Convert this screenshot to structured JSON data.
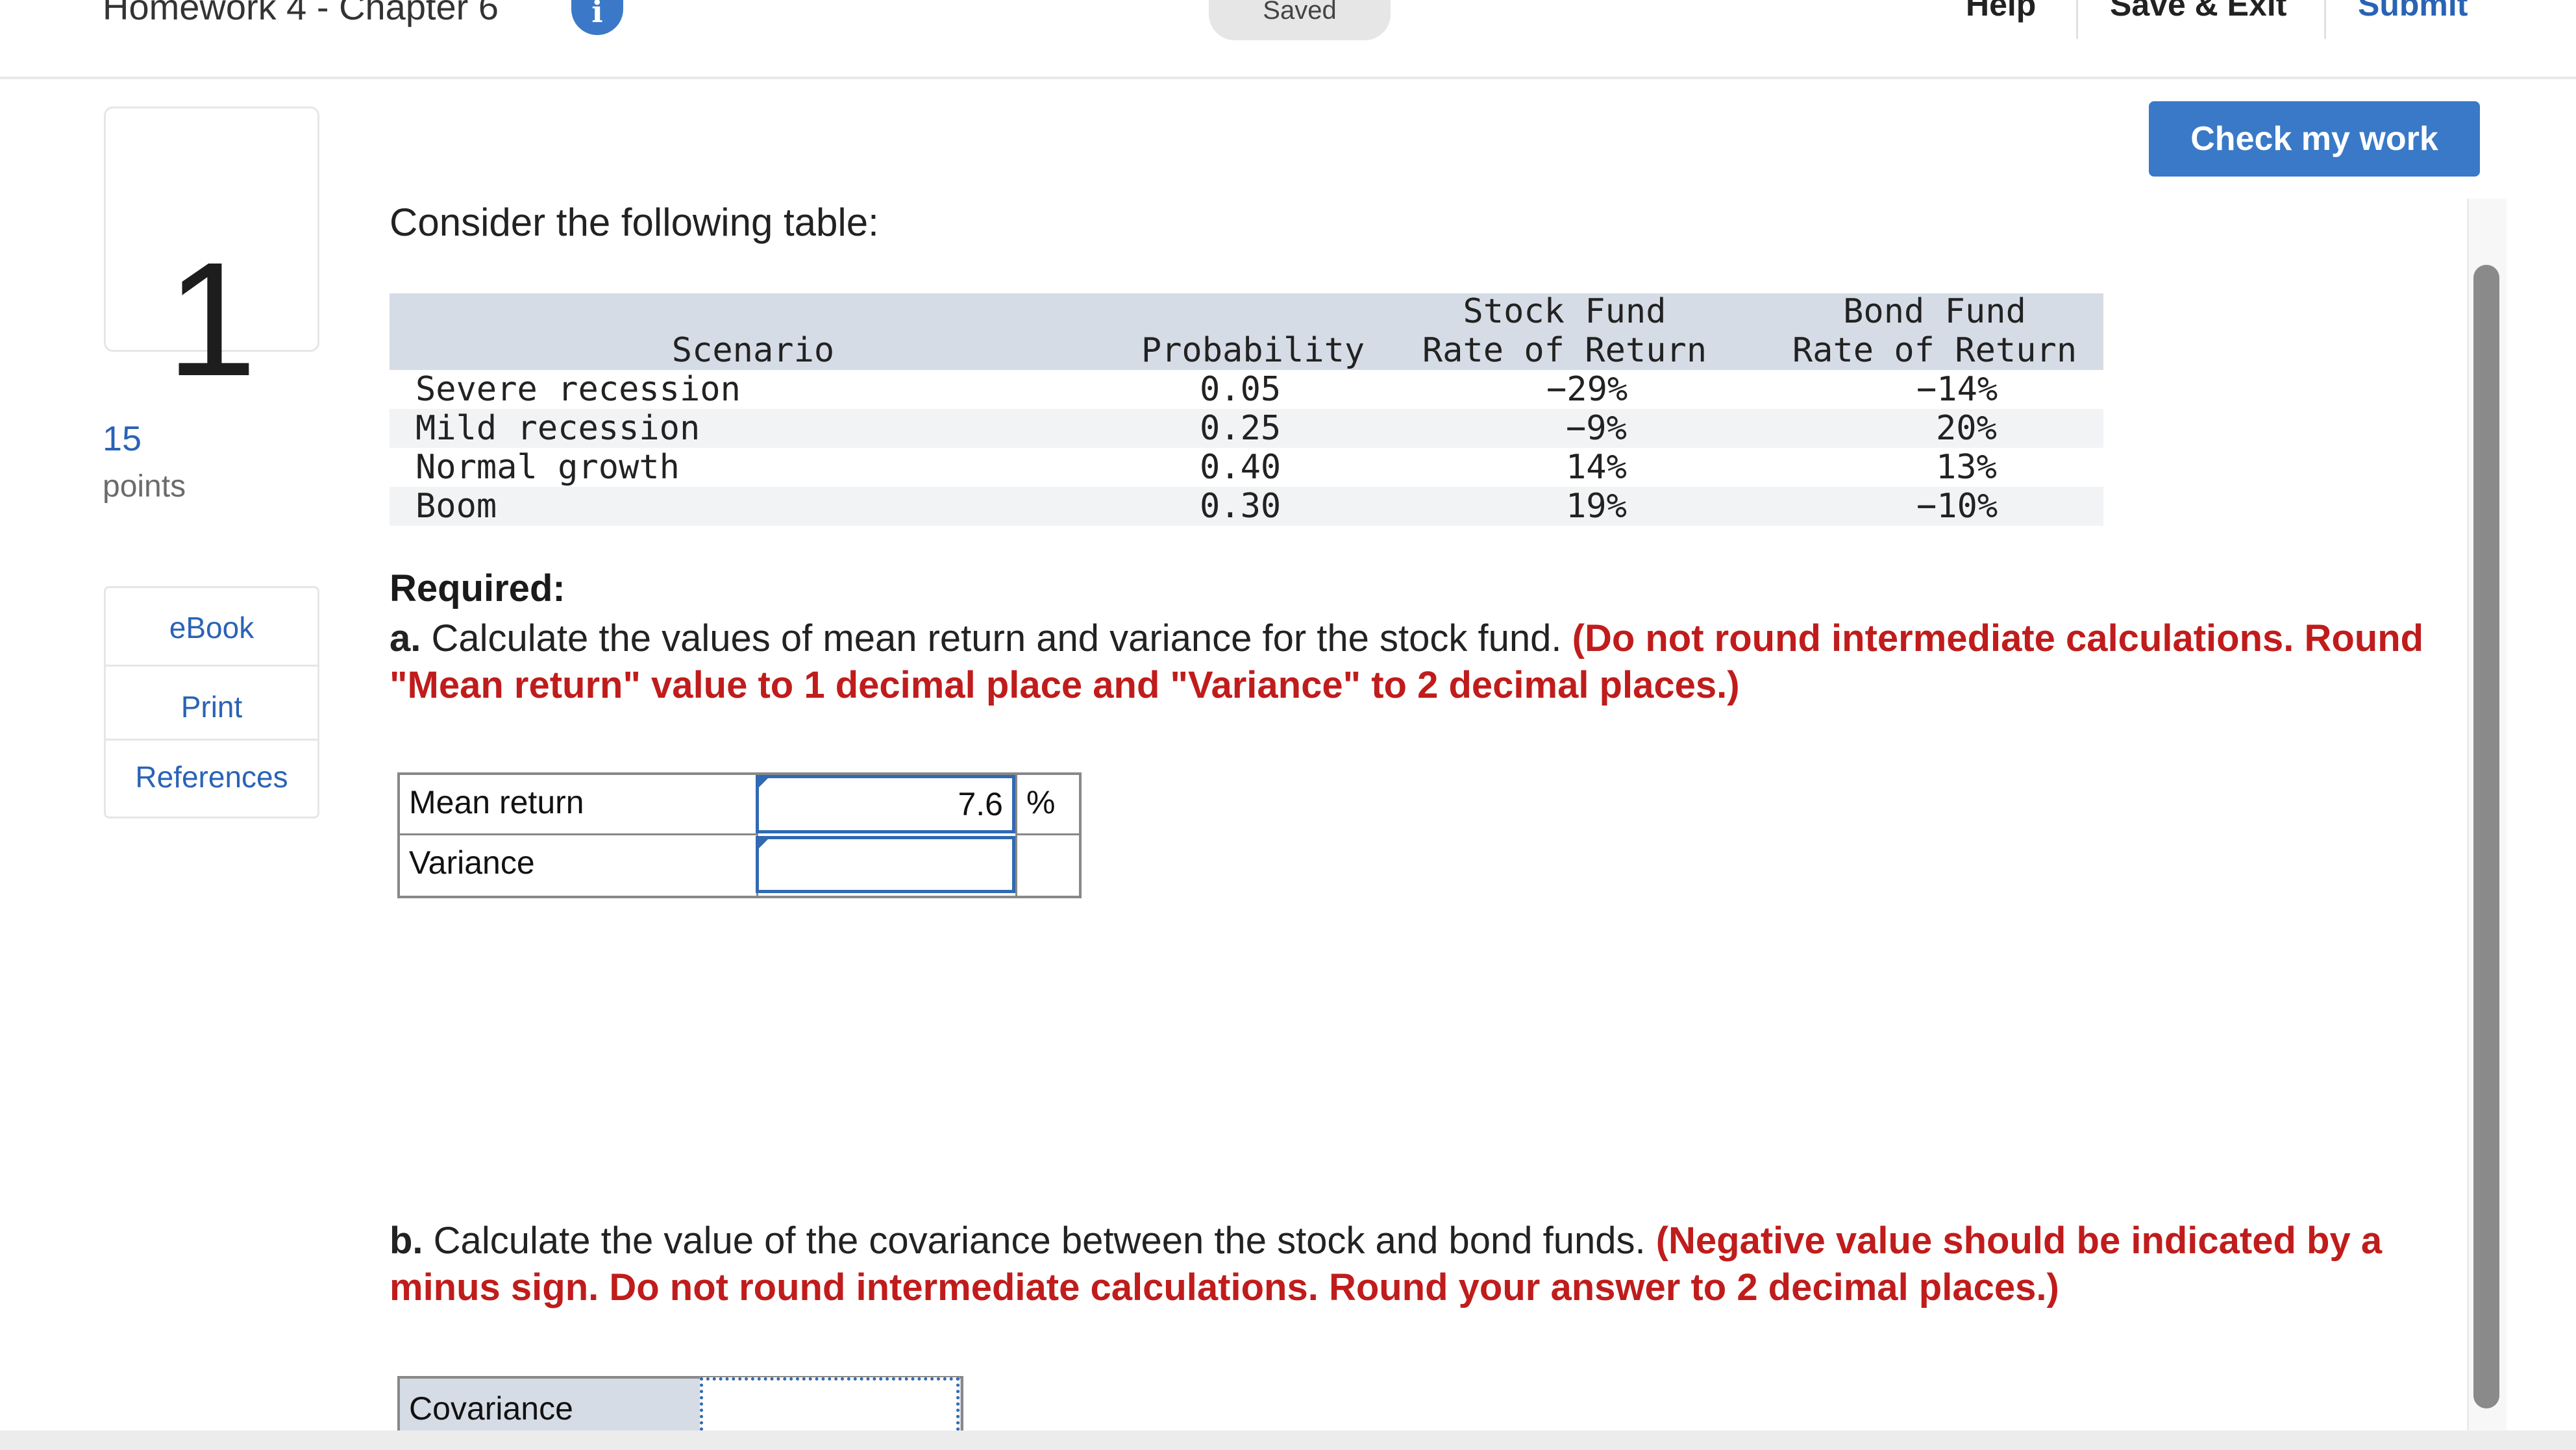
{
  "header": {
    "title": "Homework 4 - Chapter 6",
    "info_icon": "info-icon",
    "status": "Saved",
    "help": "Help",
    "save_exit": "Save & Exit",
    "submit": "Submit"
  },
  "question": {
    "number": "1",
    "points": "15",
    "points_label": "points"
  },
  "resources": [
    "eBook",
    "Print",
    "References"
  ],
  "check_button": "Check my work",
  "prompt": "Consider the following table:",
  "table": {
    "headers": {
      "scenario": "Scenario",
      "probability": "Probability",
      "stock_line1": "Stock Fund",
      "stock_line2": "Rate of Return",
      "bond_line1": "Bond Fund",
      "bond_line2": "Rate of Return"
    },
    "rows": [
      {
        "scenario": "Severe recession",
        "probability": "0.05",
        "stock": "−29%",
        "bond": "−14%"
      },
      {
        "scenario": "Mild recession",
        "probability": "0.25",
        "stock": "−9%",
        "bond": "20%"
      },
      {
        "scenario": "Normal growth",
        "probability": "0.40",
        "stock": "14%",
        "bond": "13%"
      },
      {
        "scenario": "Boom",
        "probability": "0.30",
        "stock": "19%",
        "bond": "−10%"
      }
    ]
  },
  "required": "Required:",
  "part_a": {
    "label": "a.",
    "text": "Calculate the values of mean return and variance for the stock fund.",
    "instruction": "(Do not round intermediate calculations. Round \"Mean return\" value to 1 decimal place and \"Variance\" to 2 decimal places.)",
    "rows": [
      {
        "label": "Mean return",
        "value": "7.6",
        "unit": "%"
      },
      {
        "label": "Variance",
        "value": "",
        "unit": ""
      }
    ]
  },
  "part_b": {
    "label": "b.",
    "text": "Calculate the value of the covariance between the stock and bond funds.",
    "instruction": "(Negative value should be indicated by a minus sign. Do not round intermediate calculations. Round your answer to 2 decimal places.)",
    "row_label": "Covariance",
    "value": ""
  },
  "colors": {
    "accent_blue": "#3979c7",
    "link_blue": "#2a63b5",
    "instruction_red": "#c01c1c",
    "table_header_bg": "#d6dce5"
  }
}
